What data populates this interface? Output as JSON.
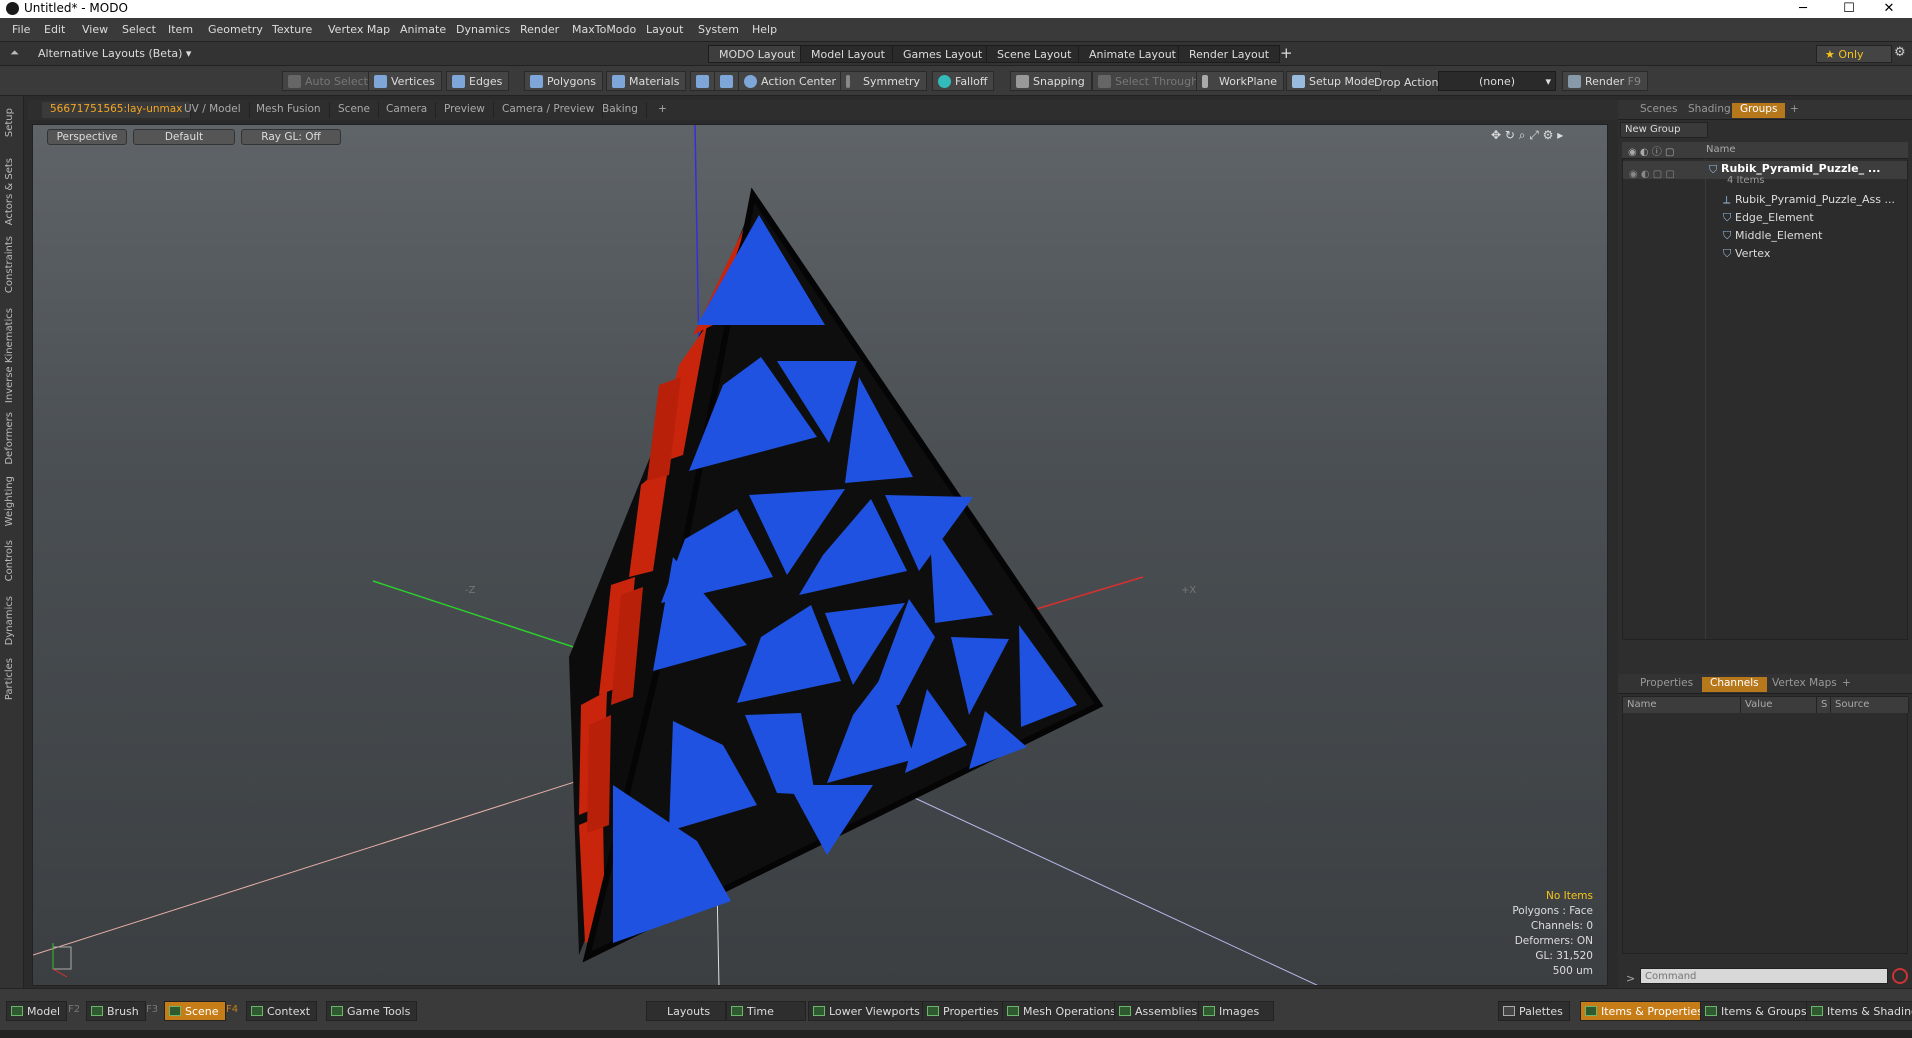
{
  "window": {
    "title": "Untitled* - MODO",
    "minimize": "─",
    "maximize": "☐",
    "close": "✕"
  },
  "menu": [
    "File",
    "Edit",
    "View",
    "Select",
    "Item",
    "Geometry",
    "Texture",
    "Vertex Map",
    "Animate",
    "Dynamics",
    "Render",
    "MaxToModo",
    "Layout",
    "System",
    "Help"
  ],
  "layouts": {
    "selector": "Alternative Layouts (Beta) ▾",
    "tabs": [
      "MODO Layout",
      "Model Layout",
      "Games Layout",
      "Scene Layout",
      "Animate Layout",
      "Render Layout"
    ],
    "add": "+",
    "only": "★  Only"
  },
  "toolbar": {
    "auto_select": "Auto Select",
    "vertices": "Vertices",
    "edges": "Edges",
    "polygons": "Polygons",
    "materials": "Materials",
    "action_center": "Action Center",
    "symmetry": "Symmetry",
    "falloff": "Falloff",
    "snapping": "Snapping",
    "select_through": "Select Through",
    "workplane": "WorkPlane",
    "setup_mode": "Setup Mode",
    "drop_action": "Drop Action",
    "drop_value": "(none)",
    "render": "Render",
    "render_key": "F9"
  },
  "left_tabs": [
    "Setup",
    "Actors & Sets",
    "Constraints",
    "Inverse Kinematics",
    "Deformers",
    "Weighting",
    "Controls",
    "Dynamics",
    "Particles"
  ],
  "viewport_tabs": [
    "56671751565:lay-unmax",
    "UV / Model",
    "Mesh Fusion",
    "Scene",
    "Camera",
    "Preview",
    "Camera / Preview",
    "Baking",
    "+"
  ],
  "viewport": {
    "view": "Perspective",
    "shading": "Default",
    "raygl": "Ray GL: Off",
    "axis_neg_z": "-Z",
    "axis_pos_x": "+X",
    "info": {
      "no_items": "No Items",
      "polygons": "Polygons : Face",
      "channels": "Channels: 0",
      "deformers": "Deformers: ON",
      "gl": "GL: 31,520",
      "scale": "500 um"
    }
  },
  "groups_panel": {
    "tabs": [
      "Scenes",
      "Shading",
      "Groups",
      "+"
    ],
    "new_group": "New Group",
    "name_col": "Name",
    "root": "Rubik_Pyramid_Puzzle_ ...",
    "root_count": "4 Items",
    "items": [
      "Rubik_Pyramid_Puzzle_Ass ...",
      "Edge_Element",
      "Middle_Element",
      "Vertex"
    ]
  },
  "channels_panel": {
    "tabs": [
      "Properties",
      "Channels",
      "Vertex Maps",
      "+"
    ],
    "cols": [
      "Name",
      "Value",
      "S",
      "Source"
    ]
  },
  "command": {
    "placeholder": "Command",
    "prompt": ">"
  },
  "bottom": {
    "model": "Model",
    "model_key": "F2",
    "brush": "Brush",
    "brush_key": "F3",
    "scene": "Scene",
    "scene_key": "F4",
    "context": "Context",
    "game_tools": "Game Tools",
    "layouts": "Layouts",
    "time": "Time",
    "lower_viewports": "Lower Viewports",
    "properties": "Properties",
    "mesh_operations": "Mesh Operations",
    "assemblies": "Assemblies",
    "images": "Images",
    "palettes": "Palettes",
    "items_properties": "Items & Properties",
    "items_groups": "Items & Groups",
    "items_shading": "Items & Shading"
  },
  "colors": {
    "accent": "#c77d17",
    "face_blue": "#1f52e0",
    "face_red": "#d0210b",
    "frame": "#0f0f0f"
  }
}
